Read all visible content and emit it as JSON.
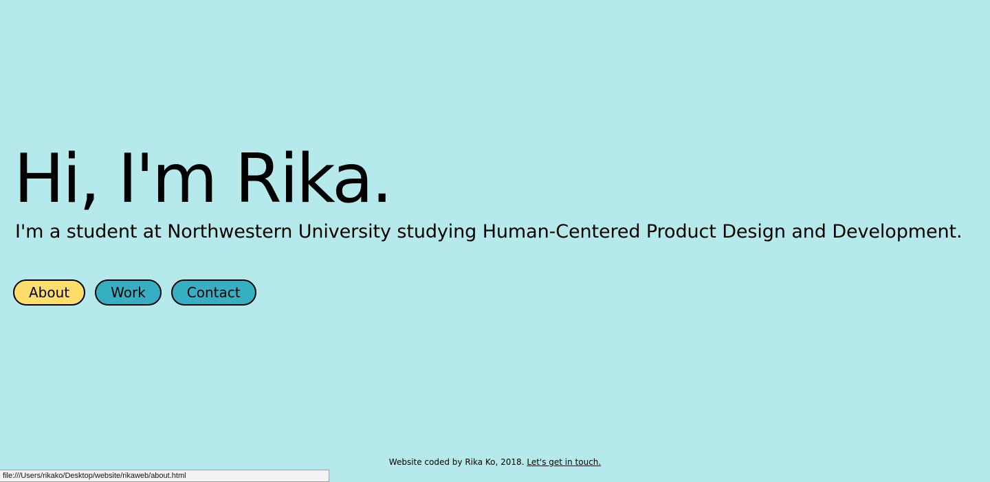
{
  "page": {
    "background_color": "#b5e9ec"
  },
  "hero": {
    "title": "Hi, I'm Rika.",
    "subtitle": "I'm a student at Northwestern University studying Human-Centered Product Design and Development."
  },
  "nav": {
    "buttons": [
      {
        "label": "About",
        "color": "#fddd6b"
      },
      {
        "label": "Work",
        "color": "#37afc3"
      },
      {
        "label": "Contact",
        "color": "#37afc3"
      }
    ]
  },
  "footer": {
    "text": "Website coded by Rika Ko, 2018.",
    "link_text": "Let's get in touch."
  },
  "status_bar": {
    "url": "file:///Users/rikako/Desktop/website/rikaweb/about.html"
  }
}
